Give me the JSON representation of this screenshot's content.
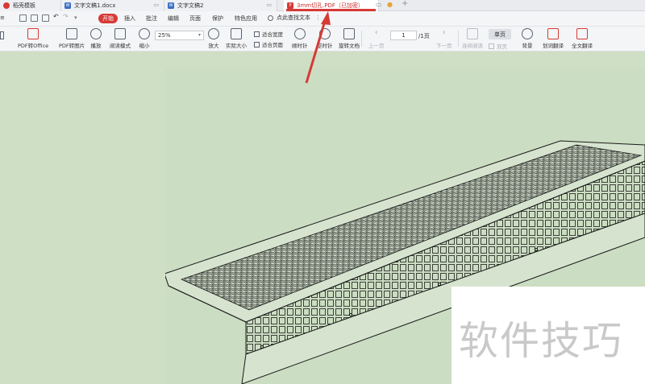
{
  "tabs": [
    {
      "label": "稻壳模板",
      "icon": "wps-logo-icon",
      "color": "#d63a35"
    },
    {
      "label": "文字文稿1.docx",
      "icon": "word-doc-icon",
      "color": "#3c6fc4"
    },
    {
      "label": "文字文稿2",
      "icon": "word-doc-icon",
      "color": "#3c6fc4"
    },
    {
      "label": "3mm切孔.PDF（已加密）",
      "icon": "pdf-icon",
      "color": "#d63a35"
    }
  ],
  "menu": {
    "start": "开始",
    "items": [
      "插入",
      "批注",
      "编辑",
      "页面",
      "保护",
      "特色应用"
    ],
    "search": "点此查找文本"
  },
  "toolbar": {
    "pdf_to_office": "PDF转Office",
    "pdf_to_image": "PDF转图片",
    "play": "播放",
    "read_mode": "阅读模式",
    "zoom_out": "缩小",
    "zoom_value": "25%",
    "zoom_in": "放大",
    "actual_size": "实际大小",
    "fit_width": "适合宽度",
    "fit_page": "适合页面",
    "rotate_cw": "顺时针",
    "rotate_ccw": "逆时针",
    "rotate_doc": "旋转文档",
    "prev_page": "上一页",
    "page_current": "1",
    "page_total": "/1页",
    "next_page": "下一页",
    "continuous": "连续阅读",
    "single_page": "单页",
    "double_page": "双页",
    "background": "背景",
    "translate_word": "划词翻译",
    "translate_all": "全文翻译"
  },
  "watermark": "软件技巧",
  "colors": {
    "accent": "#d63a35",
    "page_background": "#cfdfc6"
  }
}
